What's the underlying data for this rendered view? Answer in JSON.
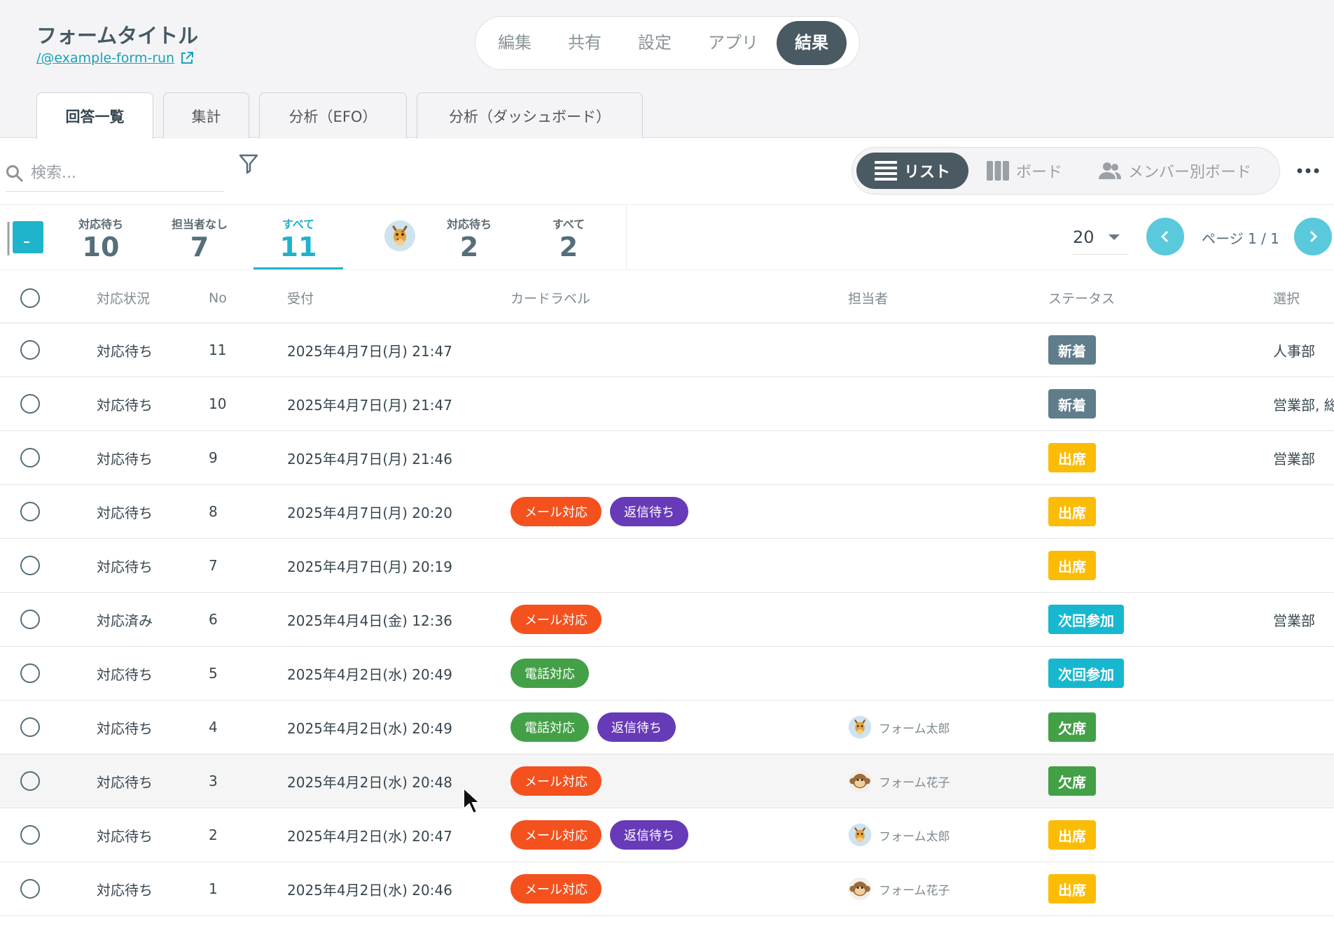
{
  "header": {
    "form_title": "フォームタイトル",
    "form_link": "/@example-form-run",
    "mode_tabs": [
      {
        "label": "編集"
      },
      {
        "label": "共有"
      },
      {
        "label": "設定"
      },
      {
        "label": "アプリ"
      },
      {
        "label": "結果",
        "active": true
      }
    ]
  },
  "tabs": [
    {
      "label": "回答一覧",
      "active": true
    },
    {
      "label": "集計"
    },
    {
      "label": "分析（EFO）"
    },
    {
      "label": "分析（ダッシュボード）"
    }
  ],
  "toolbar": {
    "search_placeholder": "検索...",
    "view_modes": [
      {
        "label": "リスト",
        "icon": "list-icon",
        "active": true
      },
      {
        "label": "ボード",
        "icon": "board-columns-icon"
      },
      {
        "label": "メンバー別ボード",
        "icon": "members-icon"
      }
    ]
  },
  "counters": {
    "team": [
      {
        "label": "対応待ち",
        "value": "10"
      },
      {
        "label": "担当者なし",
        "value": "7"
      },
      {
        "label": "すべて",
        "value": "11",
        "active": true
      }
    ],
    "mine": [
      {
        "label": "対応待ち",
        "value": "2"
      },
      {
        "label": "すべて",
        "value": "2"
      }
    ]
  },
  "pagination": {
    "per_page": "20",
    "page_text": "ページ 1 / 1"
  },
  "table": {
    "columns": {
      "status": "対応状況",
      "no": "No",
      "received": "受付",
      "card_label": "カードラベル",
      "assignee": "担当者",
      "badge": "ステータス",
      "select": "選択"
    },
    "rows": [
      {
        "status": "対応待ち",
        "no": "11",
        "date": "2025年4月7日(月) 21:47",
        "labels": [],
        "assignee": null,
        "badge": "新着",
        "select": "人事部"
      },
      {
        "status": "対応待ち",
        "no": "10",
        "date": "2025年4月7日(月) 21:47",
        "labels": [],
        "assignee": null,
        "badge": "新着",
        "select": "営業部, 総"
      },
      {
        "status": "対応待ち",
        "no": "9",
        "date": "2025年4月7日(月) 21:46",
        "labels": [],
        "assignee": null,
        "badge": "出席",
        "select": "営業部"
      },
      {
        "status": "対応待ち",
        "no": "8",
        "date": "2025年4月7日(月) 20:20",
        "labels": [
          "メール対応",
          "返信待ち"
        ],
        "assignee": null,
        "badge": "出席",
        "select": ""
      },
      {
        "status": "対応待ち",
        "no": "7",
        "date": "2025年4月7日(月) 20:19",
        "labels": [],
        "assignee": null,
        "badge": "出席",
        "select": ""
      },
      {
        "status": "対応済み",
        "no": "6",
        "date": "2025年4月4日(金) 12:36",
        "labels": [
          "メール対応"
        ],
        "assignee": null,
        "badge": "次回参加",
        "select": "営業部"
      },
      {
        "status": "対応待ち",
        "no": "5",
        "date": "2025年4月2日(水) 20:49",
        "labels": [
          "電話対応"
        ],
        "assignee": null,
        "badge": "次回参加",
        "select": ""
      },
      {
        "status": "対応待ち",
        "no": "4",
        "date": "2025年4月2日(水) 20:49",
        "labels": [
          "電話対応",
          "返信待ち"
        ],
        "assignee": {
          "name": "フォーム太郎",
          "avatar": "giraffe-icon"
        },
        "badge": "欠席",
        "select": ""
      },
      {
        "status": "対応待ち",
        "no": "3",
        "date": "2025年4月2日(水) 20:48",
        "labels": [
          "メール対応"
        ],
        "assignee": {
          "name": "フォーム花子",
          "avatar": "monkey-icon"
        },
        "badge": "欠席",
        "select": "",
        "hover": true
      },
      {
        "status": "対応待ち",
        "no": "2",
        "date": "2025年4月2日(水) 20:47",
        "labels": [
          "メール対応",
          "返信待ち"
        ],
        "assignee": {
          "name": "フォーム太郎",
          "avatar": "giraffe-icon"
        },
        "badge": "出席",
        "select": ""
      },
      {
        "status": "対応待ち",
        "no": "1",
        "date": "2025年4月2日(水) 20:46",
        "labels": [
          "メール対応"
        ],
        "assignee": {
          "name": "フォーム花子",
          "avatar": "monkey-icon"
        },
        "badge": "出席",
        "select": ""
      }
    ]
  },
  "colors": {
    "accent": "#1fb3cc",
    "label_colors": {
      "メール対応": "#f4511e",
      "返信待ち": "#673ab7",
      "電話対応": "#43a047"
    },
    "badge_colors": {
      "新着": "#607d8b",
      "出席": "#fbbc05",
      "次回参加": "#17b8cf",
      "欠席": "#43a047"
    }
  }
}
